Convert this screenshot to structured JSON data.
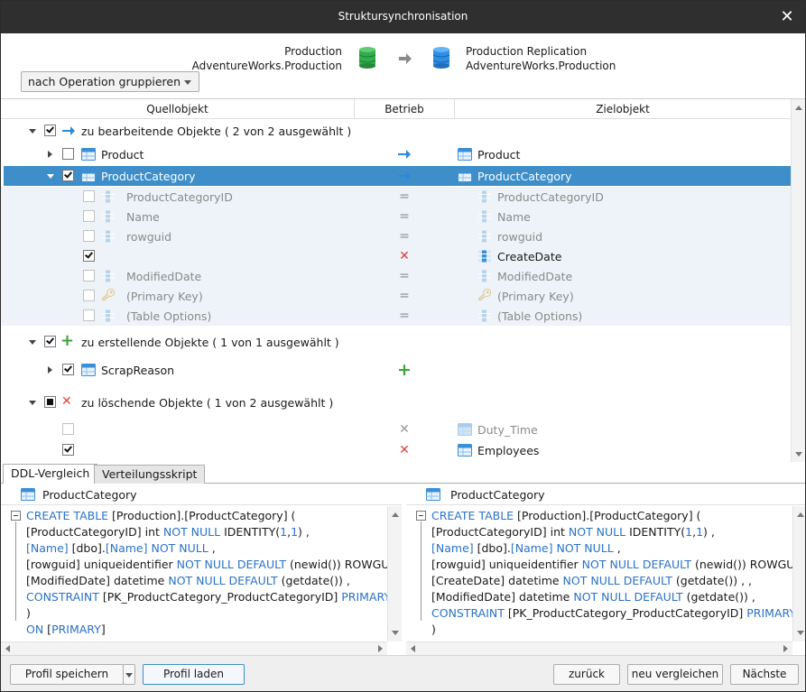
{
  "window": {
    "title": "Struktursynchronisation"
  },
  "source": {
    "line1": "Production",
    "line2": "AdventureWorks.Production"
  },
  "target": {
    "line1": "Production Replication",
    "line2": "AdventureWorks.Production"
  },
  "group_select": {
    "value": "nach Operation gruppieren"
  },
  "columns": {
    "source": "Quellobjekt",
    "operation": "Betrieb",
    "target": "Zielobjekt"
  },
  "groups": {
    "modify": {
      "label": "zu bearbeitende Objekte ( 2 von 2 ausgewählt )"
    },
    "create": {
      "label": "zu erstellende Objekte ( 1 von 1 ausgewählt )"
    },
    "delete": {
      "label": "zu löschende Objekte ( 1 von 2 ausgewählt )"
    }
  },
  "rows": {
    "product": {
      "source": "Product",
      "target": "Product"
    },
    "productcategory": {
      "source": "ProductCategory",
      "target": "ProductCategory"
    },
    "c1": {
      "source": "ProductCategoryID",
      "target": "ProductCategoryID"
    },
    "c2": {
      "source": "Name",
      "target": "Name"
    },
    "c3": {
      "source": "rowguid",
      "target": "rowguid"
    },
    "c4": {
      "source": "",
      "target": "CreateDate"
    },
    "c5": {
      "source": "ModifiedDate",
      "target": "ModifiedDate"
    },
    "c6": {
      "source": "(Primary Key)",
      "target": "(Primary Key)"
    },
    "c7": {
      "source": "(Table Options)",
      "target": "(Table Options)"
    },
    "scrap": {
      "source": "ScrapReason",
      "target": ""
    },
    "d1": {
      "source": "",
      "target": "Duty_Time"
    },
    "d2": {
      "source": "",
      "target": "Employees"
    }
  },
  "tabs": {
    "ddl": "DDL-Vergleich",
    "script": "Verteilungsskript"
  },
  "ddl_left": {
    "title": "ProductCategory",
    "lines": [
      [
        [
          "kw",
          "CREATE TABLE"
        ],
        [
          "t",
          " [Production].[ProductCategory] ("
        ]
      ],
      [
        [
          "t",
          "[ProductCategoryID] int "
        ],
        [
          "kw",
          "NOT NULL"
        ],
        [
          "t",
          " IDENTITY("
        ],
        [
          "num",
          "1"
        ],
        [
          "t",
          ","
        ],
        [
          "num",
          "1"
        ],
        [
          "t",
          ") ,"
        ]
      ],
      [
        [
          "kw",
          "[Name]"
        ],
        [
          "t",
          " [dbo]."
        ],
        [
          "kw",
          "[Name]"
        ],
        [
          "t",
          " "
        ],
        [
          "kw",
          "NOT NULL"
        ],
        [
          "t",
          " ,"
        ]
      ],
      [
        [
          "t",
          "[rowguid] uniqueidentifier "
        ],
        [
          "kw",
          "NOT NULL DEFAULT"
        ],
        [
          "t",
          " (newid()) ROWGUIDCOL"
        ]
      ],
      [
        [
          "t",
          "[ModifiedDate] datetime "
        ],
        [
          "kw",
          "NOT NULL DEFAULT"
        ],
        [
          "t",
          " (getdate()) ,"
        ]
      ],
      [
        [
          "kw",
          "CONSTRAINT"
        ],
        [
          "t",
          " [PK_ProductCategory_ProductCategoryID] "
        ],
        [
          "kw",
          "PRIMARY KEY"
        ],
        [
          "t",
          " ("
        ]
      ],
      [
        [
          "t",
          ")"
        ]
      ],
      [
        [
          "kw",
          "ON"
        ],
        [
          "t",
          " ["
        ],
        [
          "kw",
          "PRIMARY"
        ],
        [
          "t",
          "]"
        ]
      ]
    ]
  },
  "ddl_right": {
    "title": "ProductCategory",
    "lines": [
      [
        [
          "kw",
          "CREATE TABLE"
        ],
        [
          "t",
          " [Production].[ProductCategory] ("
        ]
      ],
      [
        [
          "t",
          "[ProductCategoryID] int "
        ],
        [
          "kw",
          "NOT NULL"
        ],
        [
          "t",
          " IDENTITY("
        ],
        [
          "num",
          "1"
        ],
        [
          "t",
          ","
        ],
        [
          "num",
          "1"
        ],
        [
          "t",
          ") ,"
        ]
      ],
      [
        [
          "kw",
          "[Name]"
        ],
        [
          "t",
          " [dbo]."
        ],
        [
          "kw",
          "[Name]"
        ],
        [
          "t",
          " "
        ],
        [
          "kw",
          "NOT NULL"
        ],
        [
          "t",
          " ,"
        ]
      ],
      [
        [
          "t",
          "[rowguid] uniqueidentifier "
        ],
        [
          "kw",
          "NOT NULL DEFAULT"
        ],
        [
          "t",
          " (newid()) ROWGUIDCOL"
        ]
      ],
      [
        [
          "t",
          "[CreateDate] datetime "
        ],
        [
          "kw",
          "NOT NULL DEFAULT"
        ],
        [
          "t",
          " (getdate()) , ,"
        ]
      ],
      [
        [
          "t",
          "[ModifiedDate] datetime "
        ],
        [
          "kw",
          "NOT NULL DEFAULT"
        ],
        [
          "t",
          " (getdate()) ,"
        ]
      ],
      [
        [
          "kw",
          "CONSTRAINT"
        ],
        [
          "t",
          " [PK_ProductCategory_ProductCategoryID] "
        ],
        [
          "kw",
          "PRIMARY KEY"
        ]
      ],
      [
        [
          "t",
          ")"
        ]
      ]
    ]
  },
  "buttons": {
    "save_profile": "Profil speichern",
    "load_profile": "Profil laden",
    "back": "zurück",
    "recompare": "neu vergleichen",
    "next": "Nächste"
  },
  "colors": {
    "accent": "#3d8ec9",
    "keyword": "#2a72c7",
    "add": "#3aa435",
    "delete": "#e04141",
    "titlebar": "#2f2f2f"
  }
}
